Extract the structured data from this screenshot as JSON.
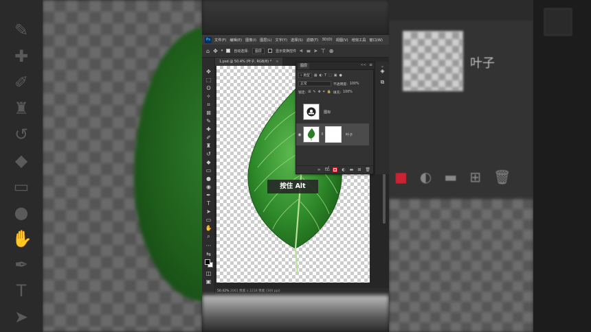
{
  "menubar": {
    "app_logo": "Ps",
    "items": [
      "文件(F)",
      "编辑(E)",
      "图像(I)",
      "图层(L)",
      "文字(Y)",
      "选择(S)",
      "滤镜(T)",
      "3D(D)",
      "视图(V)",
      "增效工具",
      "窗口(W)"
    ]
  },
  "options_bar": {
    "auto_select_label": "自动选择:",
    "auto_select_value": "图层",
    "show_transform_label": "显示变换控件"
  },
  "document": {
    "tab_title": "1.psd @ 50.4% (叶子, RGB/8) *",
    "tab_close": "×"
  },
  "layers_panel": {
    "title": "图层",
    "collapse": "<<",
    "menu": "≡",
    "filter_label": "类型",
    "blend_mode": "正常",
    "opacity_label": "不透明度:",
    "opacity_value": "100%",
    "lock_label": "锁定:",
    "fill_label": "填充:",
    "fill_value": "100%",
    "layers": [
      {
        "name": "图标",
        "visible": false,
        "selected": false
      },
      {
        "name": "叶子",
        "visible": true,
        "selected": true
      }
    ],
    "footer_icons": [
      "link-icon",
      "fx-icon",
      "add-mask-icon",
      "adjustment-icon",
      "folder-icon",
      "new-layer-icon",
      "trash-icon"
    ],
    "footer_fx": "fx"
  },
  "status_bar": {
    "zoom": "50.42%",
    "info": "2061 像素 x 2218 像素 (300 ppi)"
  },
  "overlay_hint": "按住 Alt",
  "background": {
    "layer_label": "叶子"
  },
  "colors": {
    "leaf_dark": "#1f6a1c",
    "leaf_light": "#4aa640",
    "panel_bg": "#323232",
    "accent_mask_icon": "#cc2233"
  }
}
